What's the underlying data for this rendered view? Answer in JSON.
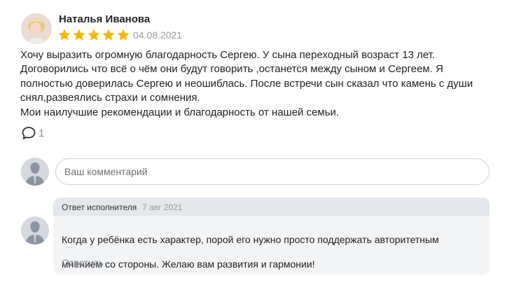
{
  "review": {
    "author": "Наталья Иванова",
    "rating": 5,
    "date": "04.08.2021",
    "text_lines": [
      "Хочу выразить огромную благодарность Сергею. У сына переходный возраст 13 лет.",
      "Договорились что всё о чём они будут говорить ,останется между сыном и Сергеем. Я",
      "полностью доверилась Сергею и неошиблась. После встречи сын сказал что камень с души",
      "снял,развеялись страхи и сомнения.",
      "Мои наилучшие рекомендации и благодарность от нашей семьи."
    ],
    "comments_count": "1"
  },
  "comment_form": {
    "placeholder": "Ваш комментарий"
  },
  "reply": {
    "role": "Ответ исполнителя",
    "date": "7 авг 2021",
    "text_lines": [
      "Когда у ребёнка есть характер, порой его нужно просто поддержать авторитетным",
      "мнением со стороны. Желаю вам развития и гармонии!"
    ],
    "action": "Ответить"
  },
  "colors": {
    "star": "#f5b800",
    "reply_bg": "#f3f4f6",
    "reply_header_bg": "#e4e7ec"
  },
  "icons": {
    "avatar": "author-photo",
    "rating": "star-icon",
    "comments": "comment-bubble-icon",
    "user": "default-user-icon"
  }
}
